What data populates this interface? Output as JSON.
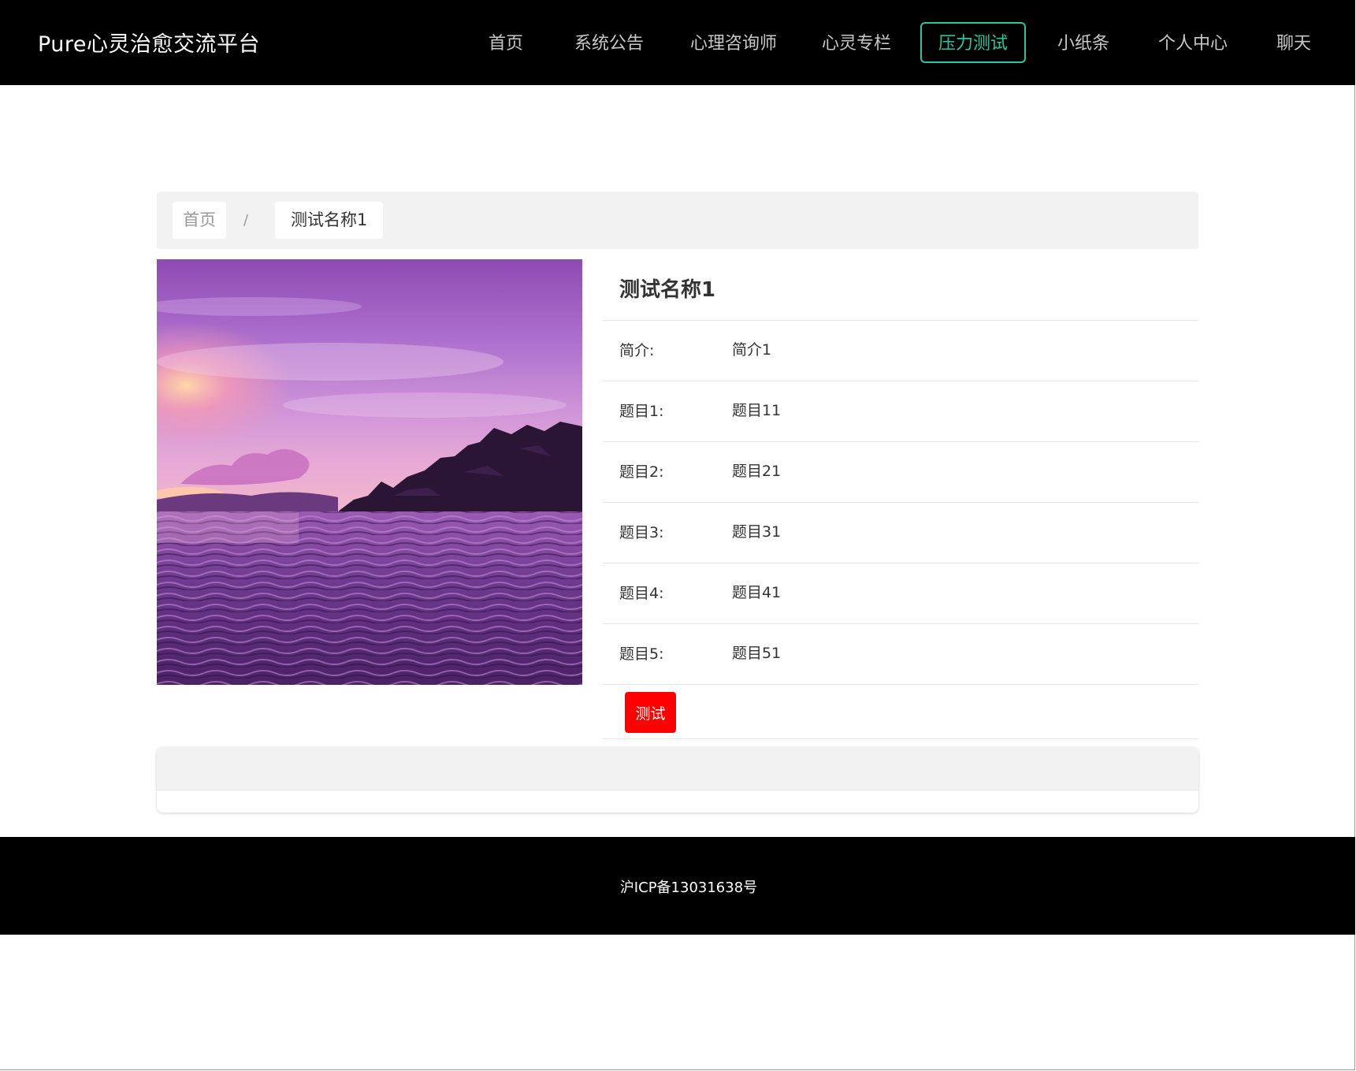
{
  "header": {
    "brand": "Pure心灵治愈交流平台",
    "nav": [
      {
        "label": "首页",
        "active": false
      },
      {
        "label": "系统公告",
        "active": false
      },
      {
        "label": "心理咨询师",
        "active": false
      },
      {
        "label": "心灵专栏",
        "active": false
      },
      {
        "label": "压力测试",
        "active": true
      },
      {
        "label": "小纸条",
        "active": false
      },
      {
        "label": "个人中心",
        "active": false
      },
      {
        "label": "聊天",
        "active": false
      }
    ],
    "active_color": "#27c6a2"
  },
  "breadcrumb": {
    "home": "首页",
    "separator": "/",
    "current": "测试名称1"
  },
  "detail": {
    "title": "测试名称1",
    "rows": [
      {
        "label": "简介:",
        "value": "简介1"
      },
      {
        "label": "题目1:",
        "value": "题目11"
      },
      {
        "label": "题目2:",
        "value": "题目21"
      },
      {
        "label": "题目3:",
        "value": "题目31"
      },
      {
        "label": "题目4:",
        "value": "题目41"
      },
      {
        "label": "题目5:",
        "value": "题目51"
      }
    ],
    "button_label": "测试",
    "button_color": "#ff0000"
  },
  "footer": {
    "icp": "沪ICP备13031638号"
  }
}
